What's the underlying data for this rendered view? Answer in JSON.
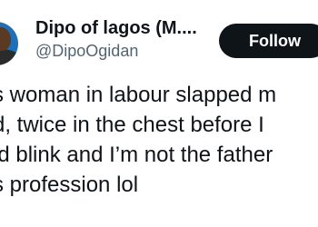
{
  "tweet": {
    "author": {
      "display_name": "Dipo of lagos (M....",
      "handle": "@DipoOgidan"
    },
    "follow_label": "Follow",
    "text_lines": [
      "s woman in labour slapped m",
      "d, twice in the chest before I",
      "ld blink and I’m not the father",
      "s profession lol"
    ]
  },
  "colors": {
    "text_primary": "#0f1419",
    "text_secondary": "#536471",
    "button_bg": "#0f1419",
    "button_text": "#ffffff",
    "avatar_bg": "#1d6fb8"
  }
}
